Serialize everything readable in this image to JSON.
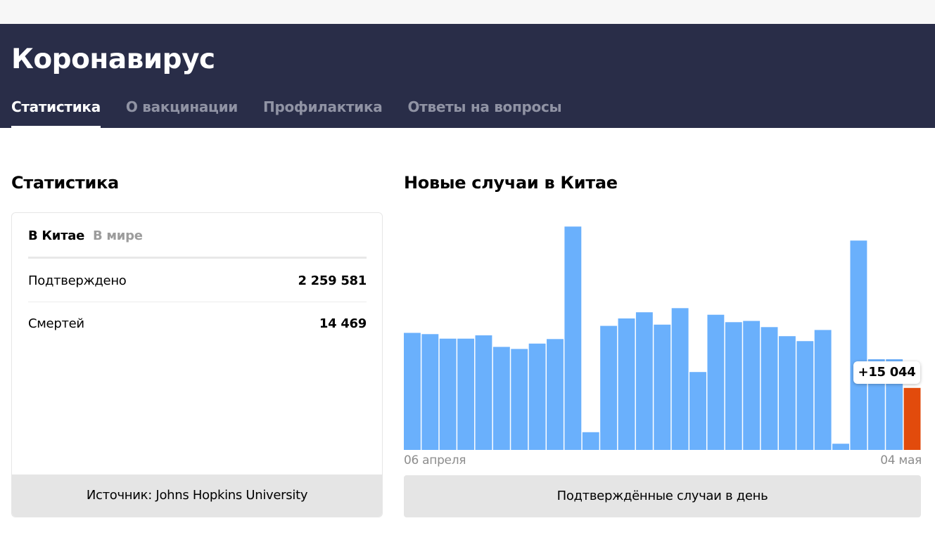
{
  "header": {
    "title": "Коронавирус",
    "tabs": [
      {
        "label": "Статистика",
        "active": true
      },
      {
        "label": "О вакцинации",
        "active": false
      },
      {
        "label": "Профилактика",
        "active": false
      },
      {
        "label": "Ответы на вопросы",
        "active": false
      }
    ]
  },
  "stats": {
    "title": "Статистика",
    "region_tabs": [
      {
        "label": "В Китае",
        "active": true
      },
      {
        "label": "В мире",
        "active": false
      }
    ],
    "rows": [
      {
        "label": "Подтверждено",
        "value": "2 259 581"
      },
      {
        "label": "Смертей",
        "value": "14 469"
      }
    ],
    "source": "Источник: Johns Hopkins University"
  },
  "chart": {
    "title": "Новые случаи в Китае",
    "start_label": "06 апреля",
    "end_label": "04 мая",
    "tooltip": "+15 044",
    "footer": "Подтверждённые случаи в день"
  },
  "colors": {
    "header_bg": "#292d48",
    "bar": "#6ab0fc",
    "bar_highlight": "#e24b0c"
  },
  "chart_data": {
    "type": "bar",
    "x": [
      "06 апреля",
      "",
      "",
      "",
      "",
      "",
      "",
      "",
      "",
      "",
      "",
      "",
      "",
      "",
      "",
      "",
      "",
      "",
      "",
      "",
      "",
      "",
      "",
      "",
      "",
      "",
      "",
      "",
      "04 мая"
    ],
    "values": [
      28400,
      28100,
      27000,
      27000,
      27800,
      25000,
      24500,
      25800,
      26900,
      54200,
      4300,
      30100,
      31900,
      33400,
      30400,
      34400,
      18900,
      32800,
      31000,
      31300,
      29800,
      27600,
      26400,
      29100,
      1500,
      50800,
      22000,
      22000,
      15044
    ],
    "highlight_index": 28,
    "ylim": [
      0,
      58000
    ]
  }
}
